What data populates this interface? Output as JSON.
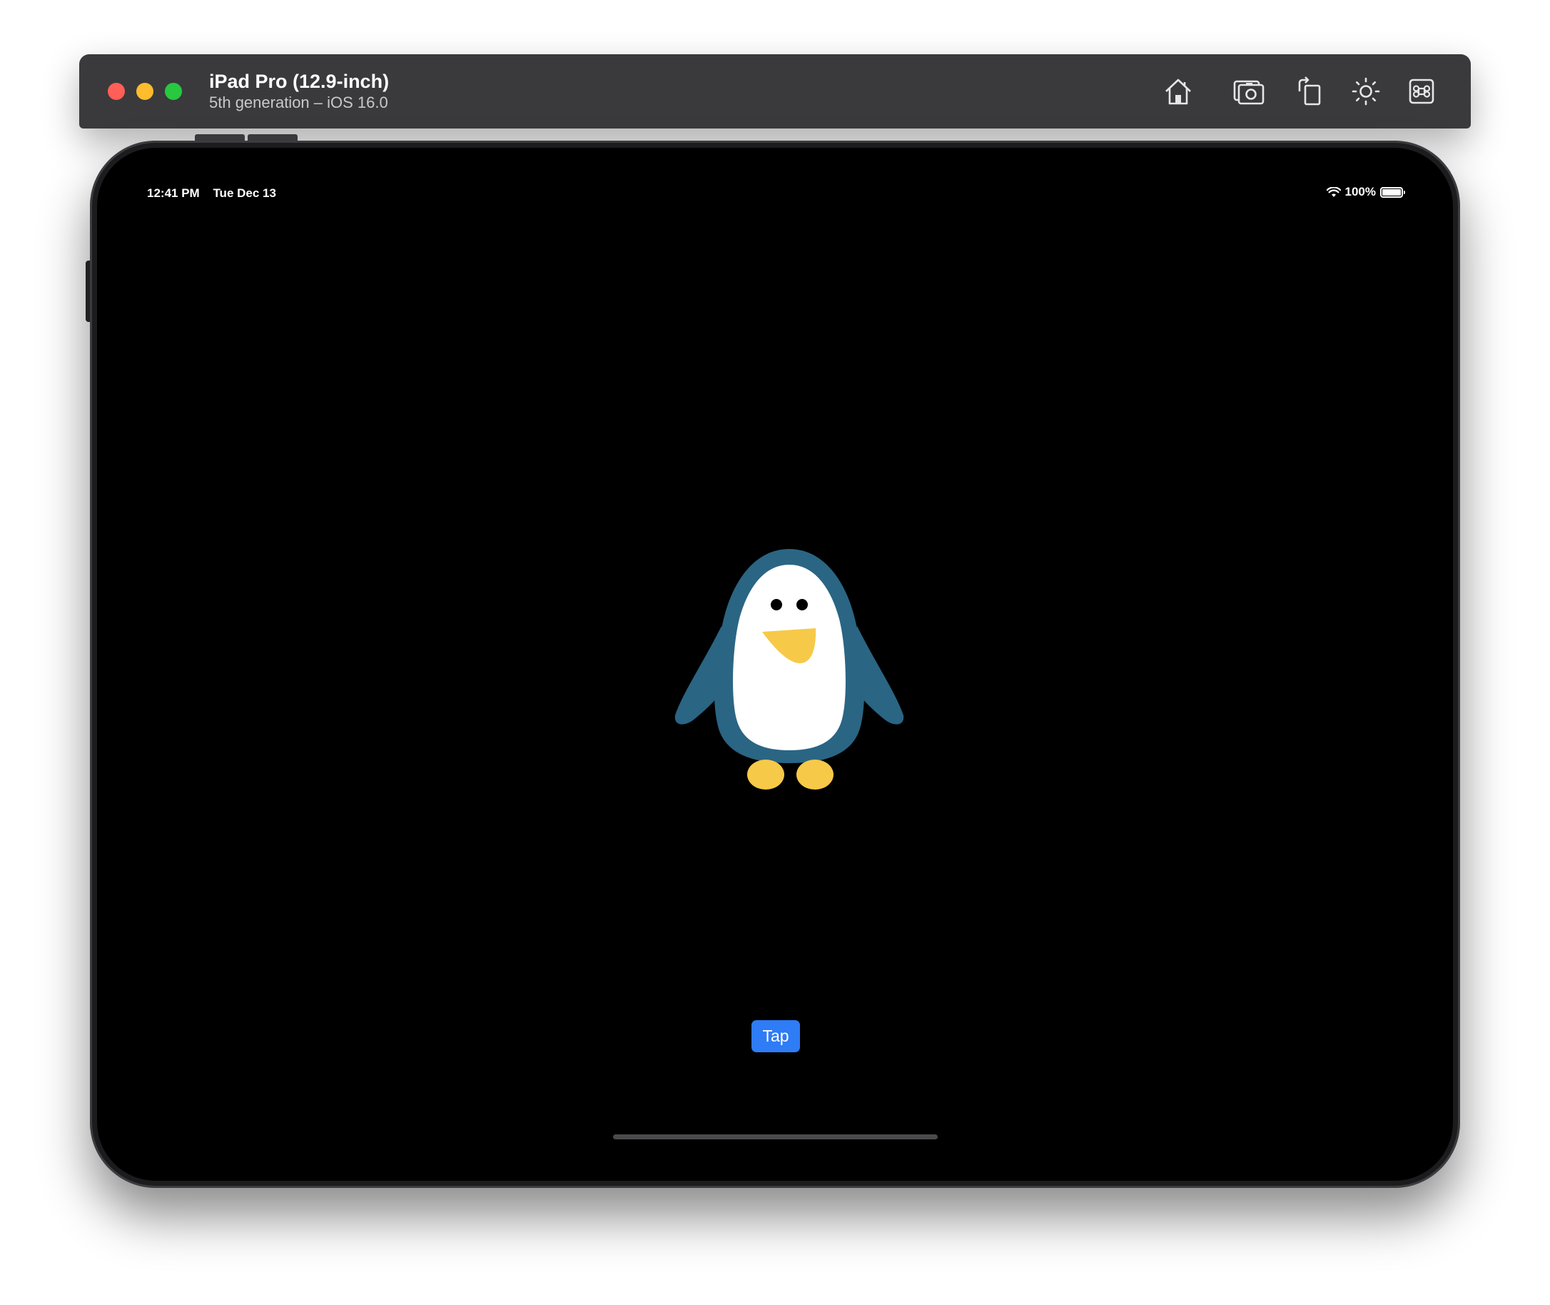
{
  "window": {
    "device_name": "iPad Pro (12.9-inch)",
    "device_subtitle": "5th generation – iOS 16.0",
    "toolbar_icons": [
      "home-icon",
      "screenshot-icon",
      "rotate-icon",
      "appearance-icon",
      "command-icon"
    ]
  },
  "status_bar": {
    "time": "12:41 PM",
    "date": "Tue Dec 13",
    "battery": "100%",
    "battery_level": 1.0
  },
  "app": {
    "illustration": "penguin",
    "tap_label": "Tap"
  },
  "colors": {
    "button_blue": "#2e7cf6",
    "penguin_body": "#2a6584",
    "penguin_belly": "#ffffff",
    "penguin_beak_feet": "#f7c948",
    "close": "#fe5f57",
    "minimize": "#febc2e",
    "zoom": "#28c840"
  }
}
